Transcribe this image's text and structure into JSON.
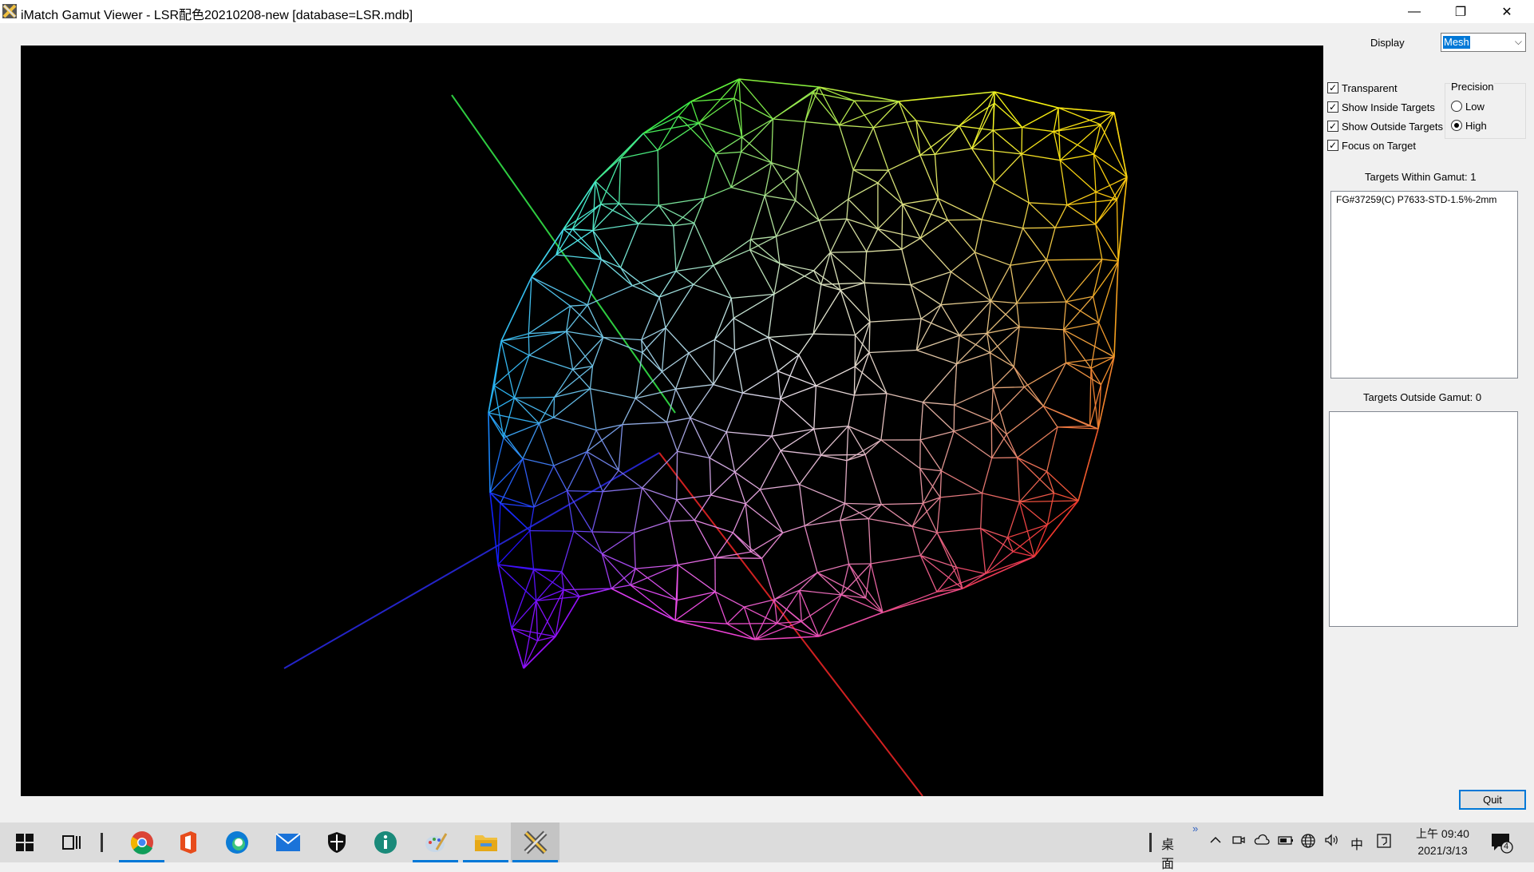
{
  "window": {
    "title": "iMatch Gamut Viewer - LSR配色20210208-new [database=LSR.mdb]",
    "minimize_glyph": "—",
    "maximize_glyph": "❐",
    "close_glyph": "✕"
  },
  "panel": {
    "display_label": "Display",
    "display_value": "Mesh",
    "checkboxes": [
      {
        "label": "Transparent",
        "checked": true
      },
      {
        "label": "Show Inside Targets",
        "checked": true
      },
      {
        "label": "Show Outside Targets",
        "checked": true
      },
      {
        "label": "Focus on Target",
        "checked": true
      }
    ],
    "precision": {
      "title": "Precision",
      "options": [
        {
          "label": "Low",
          "selected": false
        },
        {
          "label": "High",
          "selected": true
        }
      ]
    },
    "inside_heading": "Targets Within Gamut: 1",
    "inside_items": [
      "FG#37259(C) P7633-STD-1.5%-2mm"
    ],
    "outside_heading": "Targets Outside Gamut: 0",
    "outside_items": [],
    "quit_label": "Quit"
  },
  "viewer": {
    "display_mode": "Mesh",
    "axis_colors": {
      "green": "#2ecc40",
      "blue": "#2424c8",
      "red": "#d02020"
    },
    "mesh_colors": [
      "#20a0ff",
      "#40c060",
      "#a0d040",
      "#f0e040",
      "#ffb020",
      "#ff6030",
      "#ff4080",
      "#c060e0",
      "#ffffff"
    ]
  },
  "taskbar": {
    "apps": [
      "start-icon",
      "task-view-icon",
      "chrome-icon",
      "office-icon",
      "edge-icon",
      "mail-icon",
      "security-icon",
      "info-app-icon",
      "paint-icon",
      "file-explorer-icon",
      "imatch-icon"
    ],
    "desktop_label": "桌面",
    "chevron": "»",
    "ime_label": "中",
    "time": "上午 09:40",
    "date": "2021/3/13",
    "notification_count": "4"
  }
}
